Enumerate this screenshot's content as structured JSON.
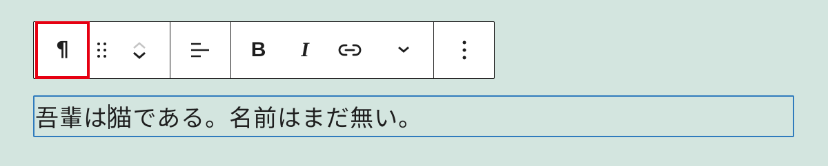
{
  "toolbar": {
    "block_type_glyph": "¶",
    "bold_label": "B",
    "italic_label": "I"
  },
  "paragraph": {
    "text_before_caret": "吾輩は",
    "text_after_caret": "猫である。名前はまだ無い。"
  },
  "colors": {
    "background": "#d3e5df",
    "highlight_border": "#e60012",
    "focus_border": "#2f7bbd",
    "icon": "#1e1e1e"
  }
}
